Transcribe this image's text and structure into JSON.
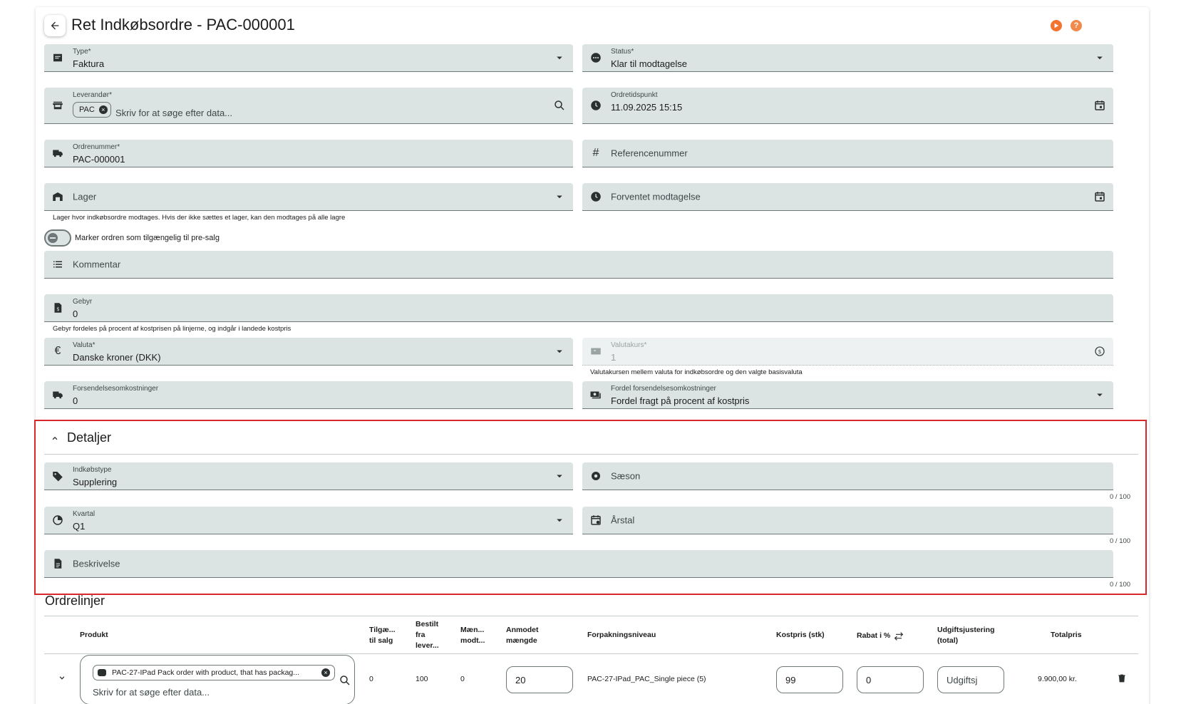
{
  "header": {
    "title": "Ret Indkøbsordre - PAC-000001",
    "accent_orange": "#f2742e",
    "help_orange": "#f0894a"
  },
  "form": {
    "type": {
      "label": "Type*",
      "value": "Faktura"
    },
    "status": {
      "label": "Status*",
      "value": "Klar til modtagelse"
    },
    "supplier": {
      "label": "Leverandør*",
      "chip": "PAC",
      "placeholder": "Skriv for at søge efter data..."
    },
    "order_time": {
      "label": "Ordretidspunkt",
      "value": "11.09.2025 15:15"
    },
    "order_number": {
      "label": "Ordrenummer*",
      "value": "PAC-000001"
    },
    "reference": {
      "placeholder": "Referencenummer"
    },
    "warehouse": {
      "placeholder": "Lager",
      "hint": "Lager hvor indkøbsordre modtages. Hvis der ikke sættes et lager, kan den modtages på alle lagre"
    },
    "expected": {
      "placeholder": "Forventet modtagelse"
    },
    "presale_toggle": "Marker ordren som tilgængelig til pre-salg",
    "comment": {
      "placeholder": "Kommentar"
    },
    "fee": {
      "label": "Gebyr",
      "value": "0",
      "hint": "Gebyr fordeles på procent af kostprisen på linjerne, og indgår i landede kostpris"
    },
    "currency": {
      "label": "Valuta*",
      "value": "Danske kroner (DKK)"
    },
    "exchange_rate": {
      "label": "Valutakurs*",
      "value": "1",
      "hint": "Valutakursen mellem valuta for indkøbsordre og den valgte basisvaluta"
    },
    "shipping": {
      "label": "Forsendelsesomkostninger",
      "value": "0"
    },
    "shipping_split": {
      "label": "Fordel forsendelsesomkostninger",
      "value": "Fordel fragt på procent af kostpris"
    }
  },
  "details": {
    "title": "Detaljer",
    "purchase_type": {
      "label": "Indkøbstype",
      "value": "Supplering"
    },
    "season": {
      "placeholder": "Sæson",
      "counter": "0 / 100"
    },
    "quarter": {
      "label": "Kvartal",
      "value": "Q1"
    },
    "year": {
      "placeholder": "Årstal",
      "counter": "0 / 100"
    },
    "description": {
      "placeholder": "Beskrivelse",
      "counter": "0 / 100"
    },
    "highlight_color": "#d8282c"
  },
  "order_lines": {
    "title": "Ordrelinjer",
    "headers": {
      "product": "Produkt",
      "available_1": "Tilgæ...",
      "available_2": "til salg",
      "ordered_1": "Bestilt",
      "ordered_2": "fra",
      "ordered_3": "lever...",
      "received_1": "Mæn...",
      "received_2": "modt...",
      "requested_1": "Anmodet",
      "requested_2": "mængde",
      "packaging": "Forpakningsniveau",
      "cost": "Kostpris (stk)",
      "discount": "Rabat i %",
      "expense_1": "Udgiftsjustering",
      "expense_2": "(total)",
      "total": "Totalpris"
    },
    "rows": [
      {
        "product_chip": "PAC-27-IPad Pack order with product, that has packag...",
        "product_placeholder": "Skriv for at søge efter data...",
        "available": "0",
        "ordered": "100",
        "received": "0",
        "requested": "20",
        "packaging": "PAC-27-IPad_PAC_Single piece (5)",
        "cost": "99",
        "discount": "0",
        "expense_placeholder": "Udgiftsj",
        "total": "9.900,00 kr."
      }
    ]
  }
}
